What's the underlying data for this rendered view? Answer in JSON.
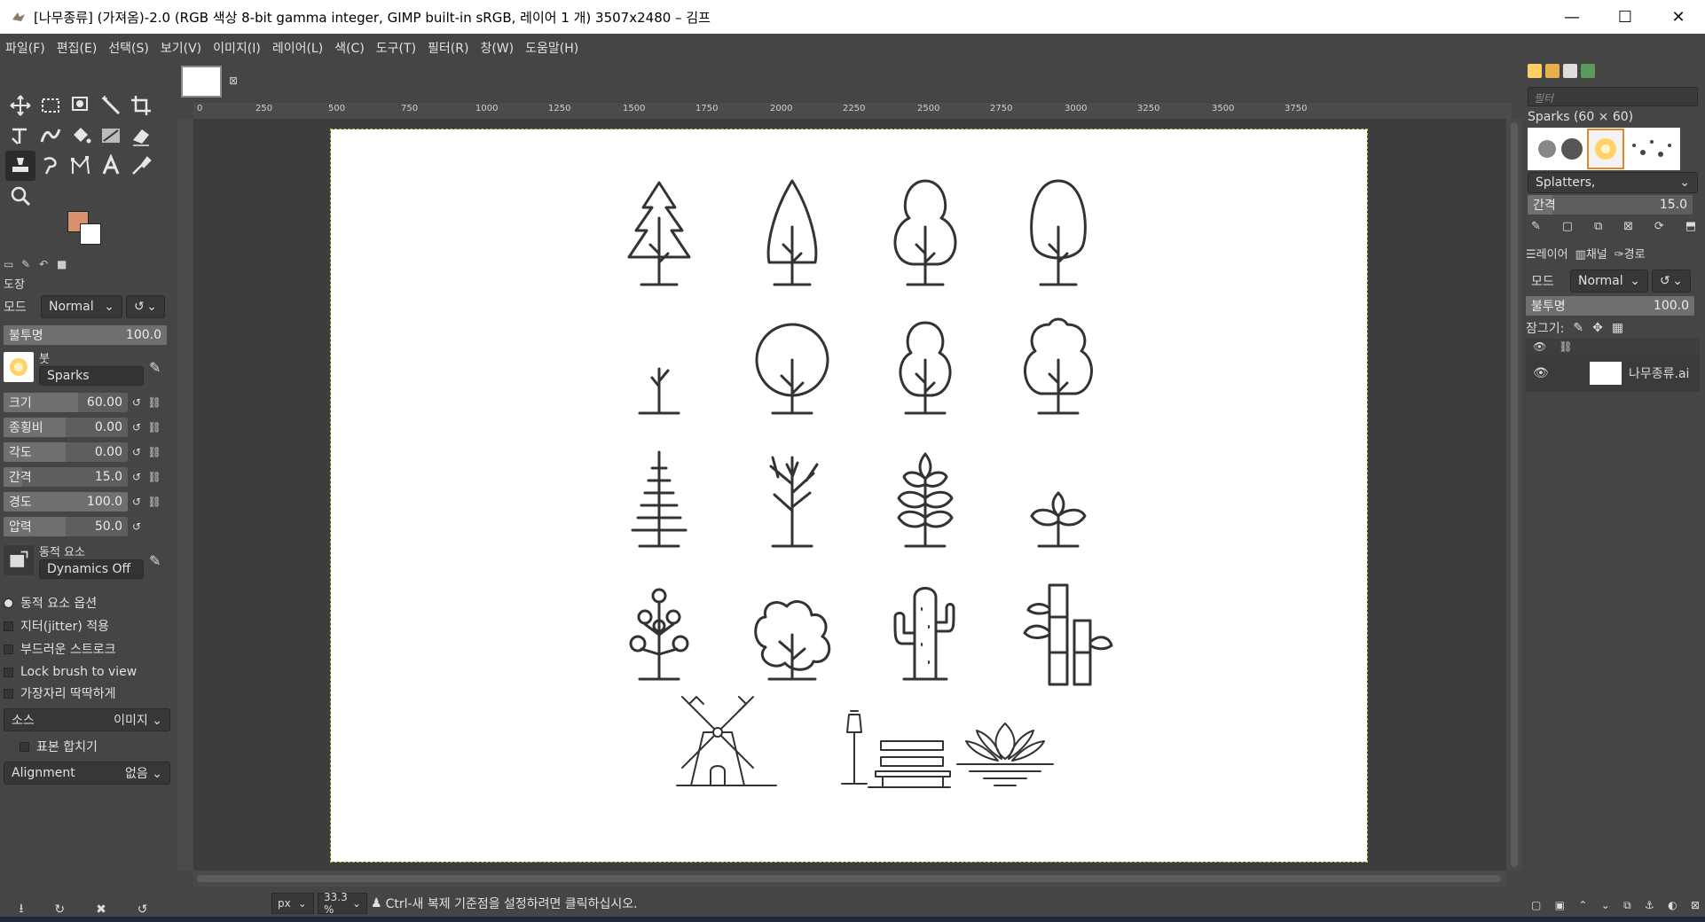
{
  "window": {
    "title": "[나무종류] (가져옴)-2.0 (RGB 색상 8-bit gamma integer, GIMP built-in sRGB, 레이어 1 개) 3507x2480 – 김프",
    "minimize": "—",
    "maximize": "☐",
    "close": "✕"
  },
  "menu": [
    "파일(F)",
    "편집(E)",
    "선택(S)",
    "보기(V)",
    "이미지(I)",
    "레이어(L)",
    "색(C)",
    "도구(T)",
    "필터(R)",
    "창(W)",
    "도움말(H)"
  ],
  "tool_options": {
    "title": "도장",
    "mode_label": "모드",
    "mode_value": "Normal",
    "opacity_label": "불투명",
    "opacity_value": "100.0",
    "brush_label": "붓",
    "brush_value": "Sparks",
    "size_label": "크기",
    "size_value": "60.00",
    "aspect_label": "종횡비",
    "aspect_value": "0.00",
    "angle_label": "각도",
    "angle_value": "0.00",
    "spacing_label": "간격",
    "spacing_value": "15.0",
    "hardness_label": "경도",
    "hardness_value": "100.0",
    "pressure_label": "압력",
    "pressure_value": "50.0",
    "dynamics_label": "동적 요소",
    "dynamics_value": "Dynamics Off",
    "dynamics_options": "동적 요소 옵션",
    "jitter": "지터(jitter) 적용",
    "smooth": "부드러운 스트로크",
    "lock_brush": "Lock brush to view",
    "hard_edge": "가장자리 딱딱하게",
    "source_label": "소스",
    "source_value": "이미지",
    "sample_merged": "표본 합치기",
    "alignment_label": "Alignment",
    "alignment_value": "없음"
  },
  "ruler": {
    "h": [
      "0",
      "250",
      "500",
      "750",
      "1000",
      "1250",
      "1500",
      "1750",
      "2000",
      "2250",
      "2500",
      "2750",
      "3000",
      "3250",
      "3500",
      "3750"
    ]
  },
  "status": {
    "unit": "px",
    "zoom": "33.3 %",
    "message": "Ctrl-새 복제 기준점을 설정하려면 클릭하십시오."
  },
  "brushes_panel": {
    "filter_placeholder": "필터",
    "brush_name": "Sparks (60 × 60)",
    "tag_value": "Splatters,",
    "spacing_label": "간격",
    "spacing_value": "15.0"
  },
  "layers_panel": {
    "tab_layers": "레이어",
    "tab_channels": "채널",
    "tab_paths": "경로",
    "mode_label": "모드",
    "mode_value": "Normal",
    "opacity_label": "불투명",
    "opacity_value": "100.0",
    "lock_label": "잠그기:",
    "layer_name": "나무종류.ai"
  },
  "colors": {
    "foreground": "#d9906e",
    "background": "#ffffff"
  }
}
